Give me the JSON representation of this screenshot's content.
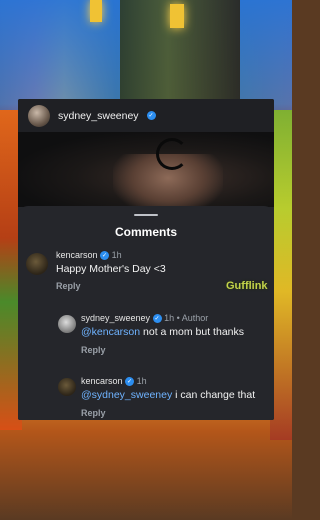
{
  "post": {
    "username": "sydney_sweeney"
  },
  "sheet": {
    "title": "Comments"
  },
  "comments": [
    {
      "username": "kencarson",
      "time": "1h",
      "author_tag": "",
      "mention": "",
      "text": "Happy Mother's Day <3",
      "reply_label": "Reply"
    },
    {
      "username": "sydney_sweeney",
      "time": "1h",
      "author_tag": "• Author",
      "mention": "@kencarson",
      "text": " not a mom but thanks",
      "reply_label": "Reply"
    },
    {
      "username": "kencarson",
      "time": "1h",
      "author_tag": "",
      "mention": "@sydney_sweeney",
      "text": " i can change that",
      "reply_label": "Reply"
    }
  ],
  "watermark": "Gufflink",
  "icons": {
    "verified": "verified-badge-icon"
  },
  "colors": {
    "sheet_bg": "#25262b",
    "mention": "#6fb3ff",
    "verified": "#2c8ef0",
    "muted": "#9aa0a8"
  }
}
